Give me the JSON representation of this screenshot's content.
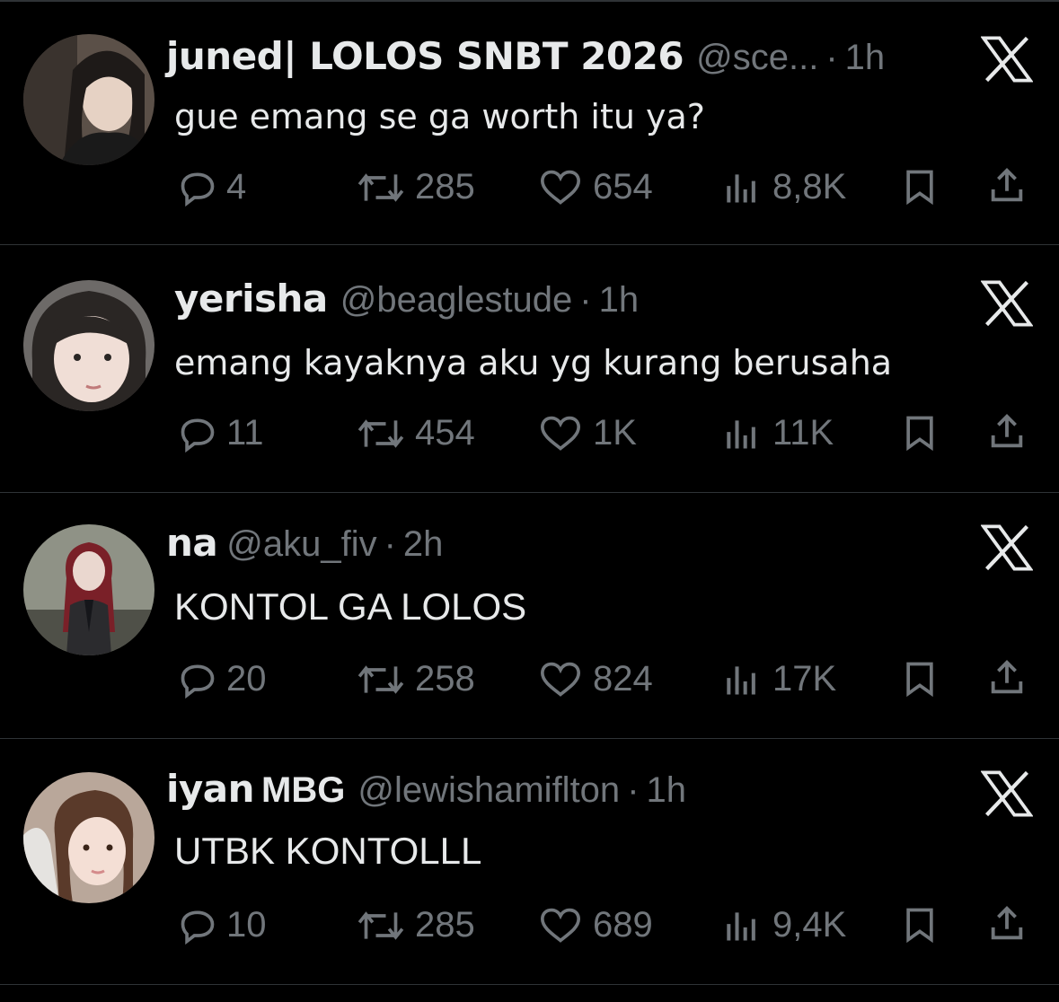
{
  "tweets": [
    {
      "name": "juned| LOLOS SNBT 2026",
      "badge": "",
      "handle": "@sce...",
      "dot": "·",
      "time": "1h",
      "text": "gue emang se ga worth itu ya?",
      "replies": "4",
      "retweets": "285",
      "likes": "654",
      "views": "8,8K"
    },
    {
      "name": "yerisha",
      "badge": "",
      "handle": "@beaglestude",
      "dot": "·",
      "time": "1h",
      "text": "emang kayaknya aku yg kurang berusaha",
      "replies": "11",
      "retweets": "454",
      "likes": "1K",
      "views": "11K"
    },
    {
      "name": "na",
      "badge": "",
      "handle": "@aku_fiv",
      "dot": "·",
      "time": "2h",
      "text": "KONTOL GA LOLOS",
      "replies": "20",
      "retweets": "258",
      "likes": "824",
      "views": "17K"
    },
    {
      "name": "iyan",
      "badge": "MBG",
      "handle": "@lewishamiflton",
      "dot": "·",
      "time": "1h",
      "text": "UTBK KONTOLLL",
      "replies": "10",
      "retweets": "285",
      "likes": "689",
      "views": "9,4K"
    }
  ],
  "icons": {
    "reply": "reply-icon",
    "retweet": "retweet-icon",
    "like": "heart-icon",
    "views": "views-icon",
    "bookmark": "bookmark-icon",
    "share": "share-icon",
    "brand": "x-logo-icon"
  },
  "colors": {
    "background": "#000000",
    "text": "#e7e9ea",
    "muted": "#71767b",
    "divider": "#2f3336"
  }
}
